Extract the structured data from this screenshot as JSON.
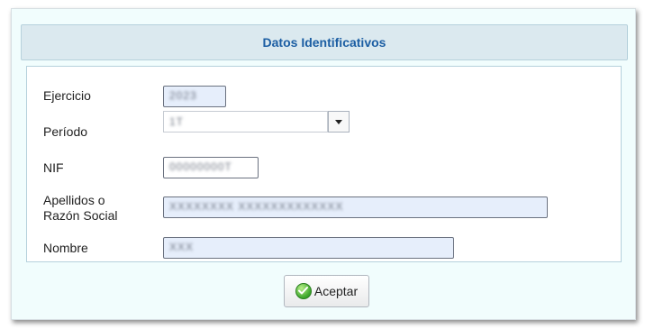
{
  "header": {
    "title": "Datos Identificativos"
  },
  "form": {
    "ejercicio": {
      "label": "Ejercicio",
      "value": "2023"
    },
    "periodo": {
      "label": "Período",
      "value": "1T"
    },
    "nif": {
      "label": "NIF",
      "value": "00000000T"
    },
    "apellidos": {
      "label_line1": "Apellidos o",
      "label_line2": "Razón Social",
      "value": "XXXXXXXX XXXXXXXXXXXXX"
    },
    "nombre": {
      "label": "Nombre",
      "value": "XXX"
    }
  },
  "buttons": {
    "accept_label": "Aceptar"
  },
  "icons": {
    "accept": "check-circle-icon",
    "dropdown": "chevron-down-icon"
  },
  "colors": {
    "header_text": "#1c5ea3",
    "field_bg": "#e6eefb",
    "dialog_bg": "#f1fdfd"
  }
}
